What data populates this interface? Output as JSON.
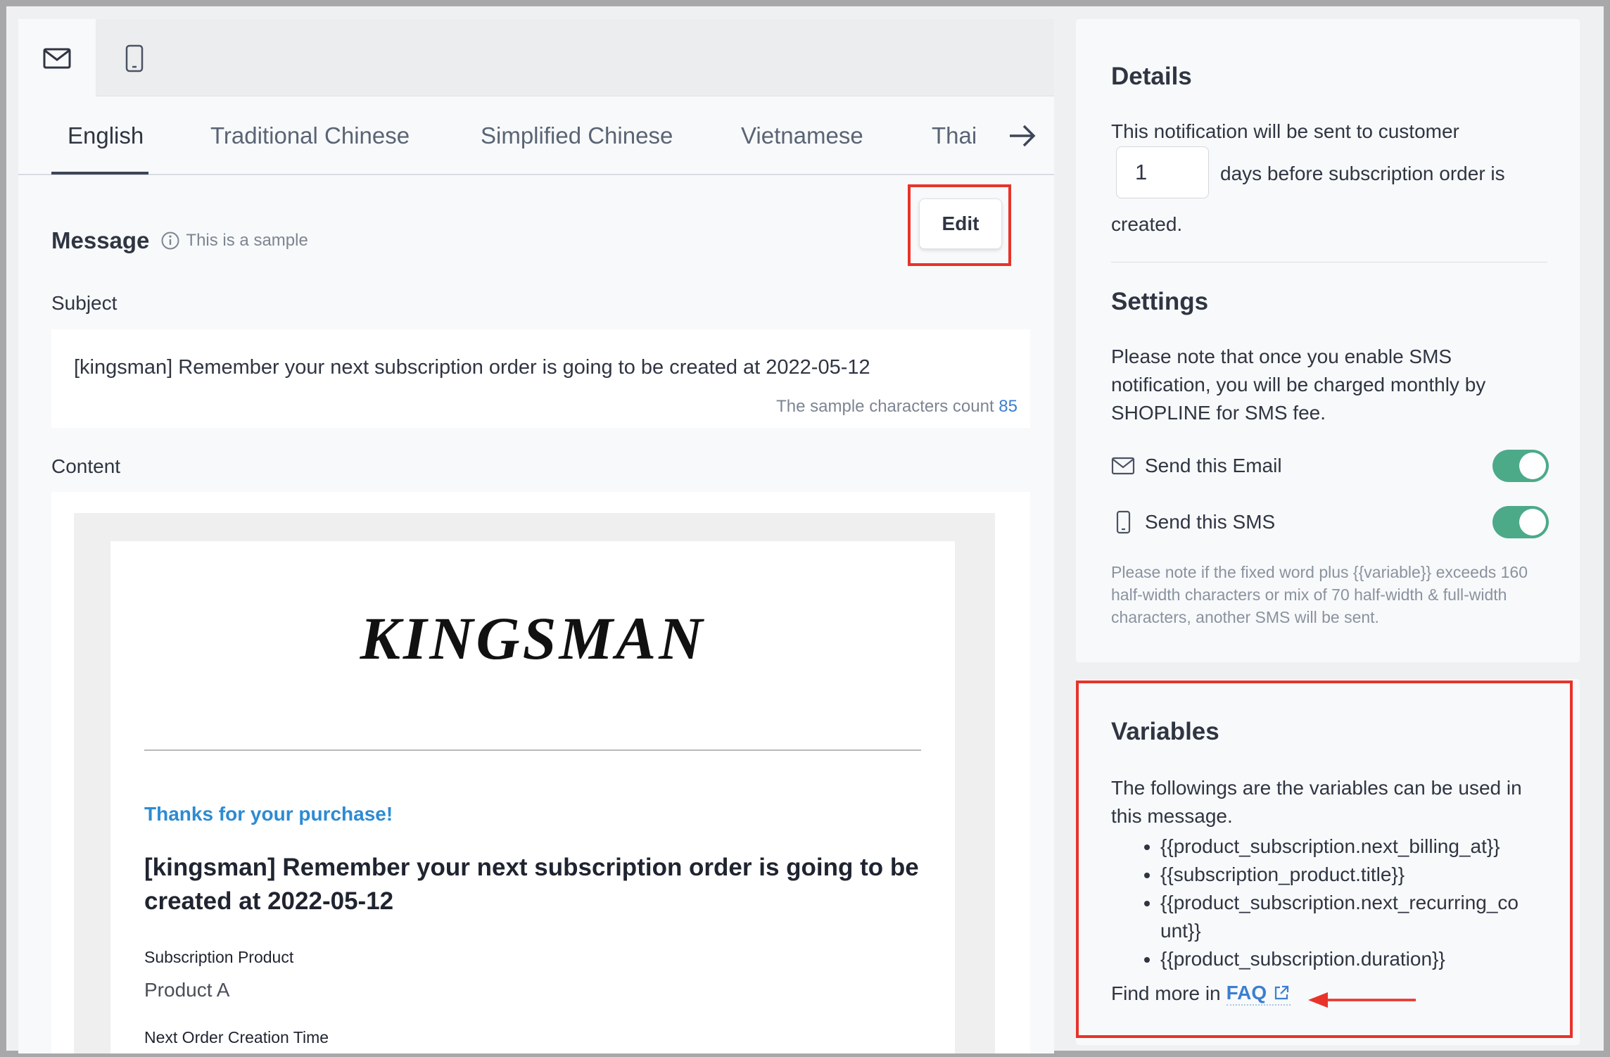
{
  "channels": [
    {
      "name": "email",
      "icon": "envelope-icon",
      "active": true
    },
    {
      "name": "sms",
      "icon": "mobile-phone-icon",
      "active": false
    }
  ],
  "languages": {
    "tabs": [
      "English",
      "Traditional Chinese",
      "Simplified Chinese",
      "Vietnamese",
      "Thai"
    ],
    "active": "English",
    "more_icon": "arrow-right-icon"
  },
  "message": {
    "title": "Message",
    "sample_note": "This is a sample",
    "edit_label": "Edit",
    "subject_label": "Subject",
    "subject_text": "[kingsman] Remember your next subscription order is going to be created at 2022-05-12",
    "char_count_label": "The sample characters count",
    "char_count": "85",
    "content_label": "Content"
  },
  "email_preview": {
    "logo": "KINGSMAN",
    "thanks": "Thanks for your purchase!",
    "heading": "[kingsman] Remember your next subscription order is going to be created at 2022-05-12",
    "subscription_product_label": "Subscription Product",
    "subscription_product_value": "Product A",
    "next_order_label": "Next Order Creation Time"
  },
  "details": {
    "title": "Details",
    "text_before": "This notification will be sent to customer",
    "days_value": "1",
    "text_after": "days before subscription order is",
    "text_end": "created."
  },
  "settings": {
    "title": "Settings",
    "note": "Please note that once you enable SMS notification, you will be charged monthly by SHOPLINE for SMS fee.",
    "email_toggle_label": "Send this Email",
    "sms_toggle_label": "Send this SMS",
    "email_enabled": true,
    "sms_enabled": true,
    "sms_note": "Please note if the fixed word plus {{variable}} exceeds 160 half-width characters or mix of 70 half-width & full-width characters, another SMS will be sent."
  },
  "variables": {
    "title": "Variables",
    "intro": "The followings are the variables can be used in this message.",
    "items": [
      "{{product_subscription.next_billing_at}}",
      "{{subscription_product.title}}",
      "{{product_subscription.next_recurring_count}}",
      "{{product_subscription.duration}}"
    ],
    "faq_prefix": "Find more in",
    "faq_link": "FAQ"
  },
  "colors": {
    "accent_blue": "#3b7fd0",
    "toggle_green": "#4caa89",
    "highlight_red": "#e8332a"
  }
}
